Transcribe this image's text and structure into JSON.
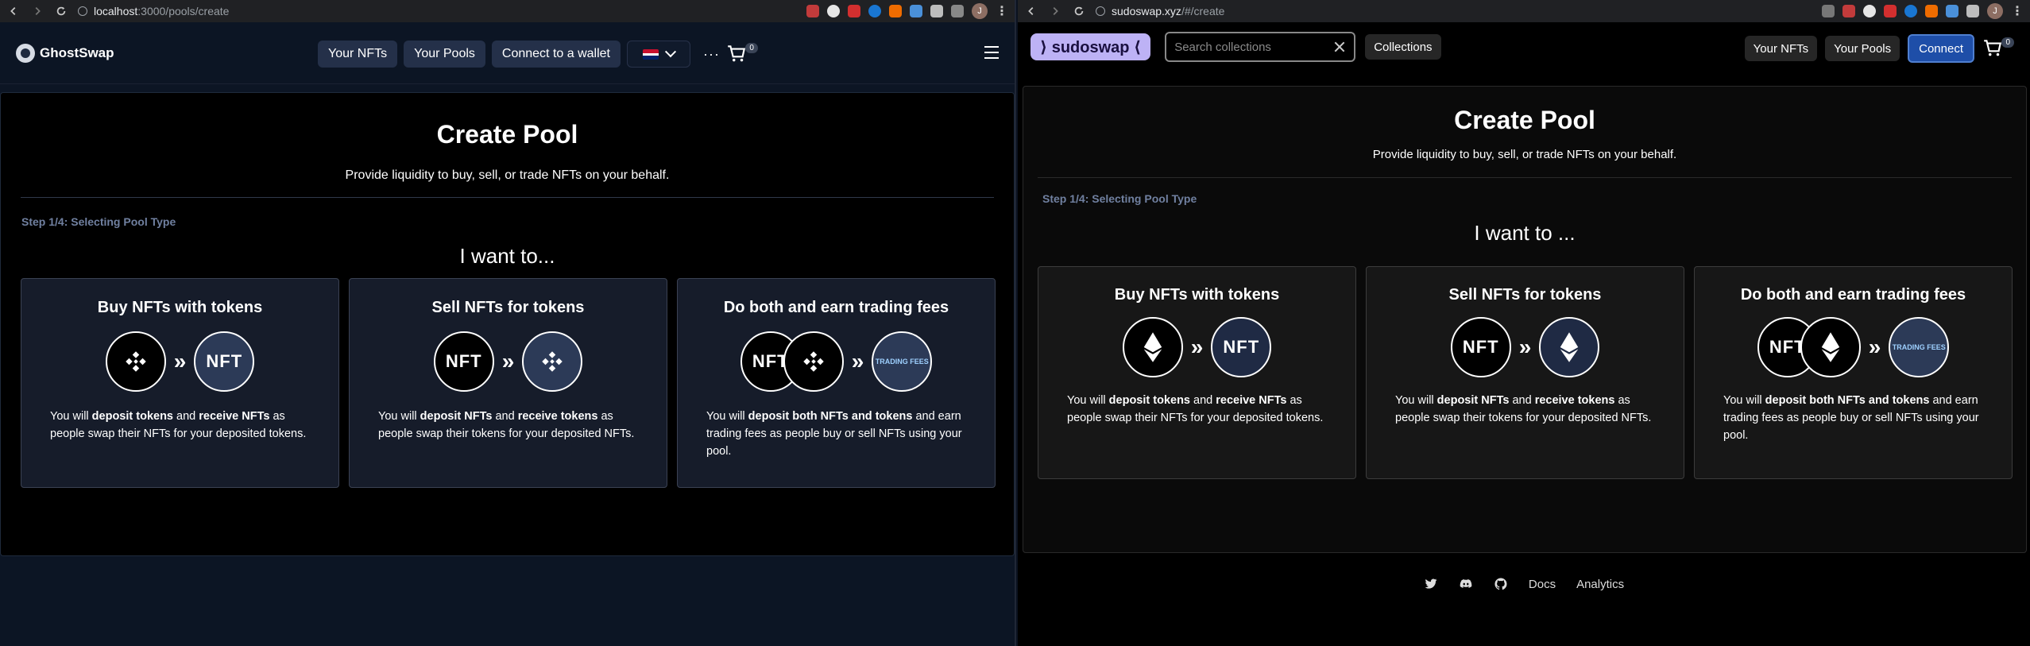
{
  "left": {
    "browser": {
      "host": "localhost",
      "path": ":3000/pools/create"
    },
    "header": {
      "logo": "GhostSwap",
      "nav": [
        "Your NFTs",
        "Your Pools",
        "Connect to a wallet"
      ],
      "language_flag": "uk-flag",
      "more": "···",
      "cart_count": "0"
    },
    "page": {
      "title": "Create Pool",
      "subtitle": "Provide liquidity to buy, sell, or trade NFTs on your behalf.",
      "step": "Step 1/4: Selecting Pool Type",
      "prompt": "I want to...",
      "cards": [
        {
          "title": "Buy NFTs with tokens",
          "p1": "You will ",
          "b1": "deposit tokens",
          "p2": " and ",
          "b2": "receive NFTs",
          "p3": " as people swap their NFTs for your deposited tokens."
        },
        {
          "title": "Sell NFTs for tokens",
          "p1": "You will ",
          "b1": "deposit NFTs",
          "p2": " and ",
          "b2": "receive tokens",
          "p3": " as people swap their tokens for your deposited NFTs."
        },
        {
          "title": "Do both and earn trading fees",
          "p1": "You will ",
          "b1": "deposit both NFTs and tokens",
          "p2": " and earn trading fees as people buy or sell NFTs using your pool.",
          "b2": "",
          "p3": ""
        }
      ]
    }
  },
  "right": {
    "browser": {
      "host": "sudoswap.xyz",
      "path": "/#/create"
    },
    "header": {
      "logo": "⟩ sudoswap ⟨",
      "search_placeholder": "Search collections",
      "collections": "Collections",
      "your_nfts": "Your NFTs",
      "your_pools": "Your Pools",
      "connect": "Connect",
      "cart_count": "0"
    },
    "page": {
      "title": "Create Pool",
      "subtitle": "Provide liquidity to buy, sell, or trade NFTs on your behalf.",
      "step": "Step 1/4: Selecting Pool Type",
      "prompt": "I want to ...",
      "cards": [
        {
          "title": "Buy NFTs with tokens",
          "p1": "You will ",
          "b1": "deposit tokens",
          "p2": " and ",
          "b2": "receive NFTs",
          "p3": " as people swap their NFTs for your deposited tokens."
        },
        {
          "title": "Sell NFTs for tokens",
          "p1": "You will ",
          "b1": "deposit NFTs",
          "p2": " and ",
          "b2": "receive tokens",
          "p3": " as people swap their tokens for your deposited NFTs."
        },
        {
          "title": "Do both and earn trading fees",
          "p1": "You will ",
          "b1": "deposit both NFTs and tokens",
          "p2": " and earn trading fees as people buy or sell NFTs using your pool.",
          "b2": "",
          "p3": ""
        }
      ]
    },
    "footer": {
      "docs": "Docs",
      "analytics": "Analytics"
    }
  },
  "icon_labels": {
    "nft": "NFT",
    "trading_fees": "TRADING FEES"
  },
  "colors": {
    "gs_bg": "#0c1524",
    "gs_card": "#161c2a",
    "sd_logo": "#bdb2f5",
    "sd_connect": "#1e4ea8"
  }
}
